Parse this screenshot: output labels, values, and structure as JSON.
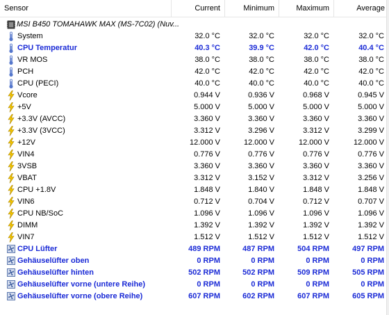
{
  "columns": {
    "sensor": "Sensor",
    "current": "Current",
    "minimum": "Minimum",
    "maximum": "Maximum",
    "average": "Average"
  },
  "device": {
    "label": "MSI B450 TOMAHAWK MAX (MS-7C02) (Nuv...",
    "icon": "chip-icon"
  },
  "rows": [
    {
      "icon": "thermometer-icon",
      "name": "System",
      "cur": "32.0 °C",
      "min": "32.0 °C",
      "max": "32.0 °C",
      "avg": "32.0 °C",
      "highlight": false
    },
    {
      "icon": "thermometer-icon",
      "name": "CPU Temperatur",
      "cur": "40.3 °C",
      "min": "39.9 °C",
      "max": "42.0 °C",
      "avg": "40.4 °C",
      "highlight": true
    },
    {
      "icon": "thermometer-icon",
      "name": "VR MOS",
      "cur": "38.0 °C",
      "min": "38.0 °C",
      "max": "38.0 °C",
      "avg": "38.0 °C",
      "highlight": false
    },
    {
      "icon": "thermometer-icon",
      "name": "PCH",
      "cur": "42.0 °C",
      "min": "42.0 °C",
      "max": "42.0 °C",
      "avg": "42.0 °C",
      "highlight": false
    },
    {
      "icon": "thermometer-icon",
      "name": "CPU (PECI)",
      "cur": "40.0 °C",
      "min": "40.0 °C",
      "max": "40.0 °C",
      "avg": "40.0 °C",
      "highlight": false
    },
    {
      "icon": "lightning-icon",
      "name": "Vcore",
      "cur": "0.944 V",
      "min": "0.936 V",
      "max": "0.968 V",
      "avg": "0.945 V",
      "highlight": false
    },
    {
      "icon": "lightning-icon",
      "name": "+5V",
      "cur": "5.000 V",
      "min": "5.000 V",
      "max": "5.000 V",
      "avg": "5.000 V",
      "highlight": false
    },
    {
      "icon": "lightning-icon",
      "name": "+3.3V (AVCC)",
      "cur": "3.360 V",
      "min": "3.360 V",
      "max": "3.360 V",
      "avg": "3.360 V",
      "highlight": false
    },
    {
      "icon": "lightning-icon",
      "name": "+3.3V (3VCC)",
      "cur": "3.312 V",
      "min": "3.296 V",
      "max": "3.312 V",
      "avg": "3.299 V",
      "highlight": false
    },
    {
      "icon": "lightning-icon",
      "name": "+12V",
      "cur": "12.000 V",
      "min": "12.000 V",
      "max": "12.000 V",
      "avg": "12.000 V",
      "highlight": false
    },
    {
      "icon": "lightning-icon",
      "name": "VIN4",
      "cur": "0.776 V",
      "min": "0.776 V",
      "max": "0.776 V",
      "avg": "0.776 V",
      "highlight": false
    },
    {
      "icon": "lightning-icon",
      "name": "3VSB",
      "cur": "3.360 V",
      "min": "3.360 V",
      "max": "3.360 V",
      "avg": "3.360 V",
      "highlight": false
    },
    {
      "icon": "lightning-icon",
      "name": "VBAT",
      "cur": "3.312 V",
      "min": "3.152 V",
      "max": "3.312 V",
      "avg": "3.256 V",
      "highlight": false
    },
    {
      "icon": "lightning-icon",
      "name": "CPU +1.8V",
      "cur": "1.848 V",
      "min": "1.840 V",
      "max": "1.848 V",
      "avg": "1.848 V",
      "highlight": false
    },
    {
      "icon": "lightning-icon",
      "name": "VIN6",
      "cur": "0.712 V",
      "min": "0.704 V",
      "max": "0.712 V",
      "avg": "0.707 V",
      "highlight": false
    },
    {
      "icon": "lightning-icon",
      "name": "CPU NB/SoC",
      "cur": "1.096 V",
      "min": "1.096 V",
      "max": "1.096 V",
      "avg": "1.096 V",
      "highlight": false
    },
    {
      "icon": "lightning-icon",
      "name": "DIMM",
      "cur": "1.392 V",
      "min": "1.392 V",
      "max": "1.392 V",
      "avg": "1.392 V",
      "highlight": false
    },
    {
      "icon": "lightning-icon",
      "name": "VIN7",
      "cur": "1.512 V",
      "min": "1.512 V",
      "max": "1.512 V",
      "avg": "1.512 V",
      "highlight": false
    },
    {
      "icon": "fan-icon",
      "name": "CPU Lüfter",
      "cur": "489 RPM",
      "min": "487 RPM",
      "max": "504 RPM",
      "avg": "497 RPM",
      "highlight": true
    },
    {
      "icon": "fan-icon",
      "name": "Gehäuselüfter oben",
      "cur": "0 RPM",
      "min": "0 RPM",
      "max": "0 RPM",
      "avg": "0 RPM",
      "highlight": true
    },
    {
      "icon": "fan-icon",
      "name": "Gehäuselüfter hinten",
      "cur": "502 RPM",
      "min": "502 RPM",
      "max": "509 RPM",
      "avg": "505 RPM",
      "highlight": true
    },
    {
      "icon": "fan-icon",
      "name": "Gehäuselüfter vorne (untere Reihe)",
      "cur": "0 RPM",
      "min": "0 RPM",
      "max": "0 RPM",
      "avg": "0 RPM",
      "highlight": true
    },
    {
      "icon": "fan-icon",
      "name": "Gehäuselüfter vorne (obere Reihe)",
      "cur": "607 RPM",
      "min": "602 RPM",
      "max": "607 RPM",
      "avg": "605 RPM",
      "highlight": true
    }
  ],
  "colors": {
    "highlight_text": "#1a2ad6",
    "thermometer": "#5577cc",
    "lightning": "#e6b800",
    "fan": "#3a5a9c"
  }
}
